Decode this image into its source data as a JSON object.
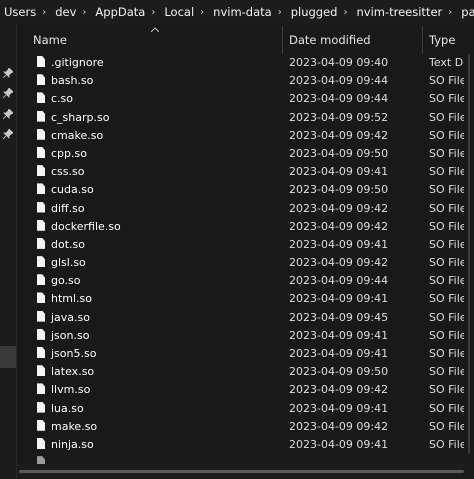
{
  "breadcrumb": [
    "Users",
    "dev",
    "AppData",
    "Local",
    "nvim-data",
    "plugged",
    "nvim-treesitter",
    "parser"
  ],
  "breadcrumb_separator": "›",
  "columns": {
    "name": "Name",
    "date_modified": "Date modified",
    "type": "Type"
  },
  "files": [
    {
      "name": ".gitignore",
      "date": "2023-04-09 09:40",
      "type": "Text Docu"
    },
    {
      "name": "bash.so",
      "date": "2023-04-09 09:44",
      "type": "SO File"
    },
    {
      "name": "c.so",
      "date": "2023-04-09 09:44",
      "type": "SO File"
    },
    {
      "name": "c_sharp.so",
      "date": "2023-04-09 09:52",
      "type": "SO File"
    },
    {
      "name": "cmake.so",
      "date": "2023-04-09 09:42",
      "type": "SO File"
    },
    {
      "name": "cpp.so",
      "date": "2023-04-09 09:50",
      "type": "SO File"
    },
    {
      "name": "css.so",
      "date": "2023-04-09 09:41",
      "type": "SO File"
    },
    {
      "name": "cuda.so",
      "date": "2023-04-09 09:50",
      "type": "SO File"
    },
    {
      "name": "diff.so",
      "date": "2023-04-09 09:42",
      "type": "SO File"
    },
    {
      "name": "dockerfile.so",
      "date": "2023-04-09 09:42",
      "type": "SO File"
    },
    {
      "name": "dot.so",
      "date": "2023-04-09 09:41",
      "type": "SO File"
    },
    {
      "name": "glsl.so",
      "date": "2023-04-09 09:42",
      "type": "SO File"
    },
    {
      "name": "go.so",
      "date": "2023-04-09 09:44",
      "type": "SO File"
    },
    {
      "name": "html.so",
      "date": "2023-04-09 09:41",
      "type": "SO File"
    },
    {
      "name": "java.so",
      "date": "2023-04-09 09:45",
      "type": "SO File"
    },
    {
      "name": "json.so",
      "date": "2023-04-09 09:41",
      "type": "SO File"
    },
    {
      "name": "json5.so",
      "date": "2023-04-09 09:41",
      "type": "SO File"
    },
    {
      "name": "latex.so",
      "date": "2023-04-09 09:50",
      "type": "SO File"
    },
    {
      "name": "llvm.so",
      "date": "2023-04-09 09:42",
      "type": "SO File"
    },
    {
      "name": "lua.so",
      "date": "2023-04-09 09:41",
      "type": "SO File"
    },
    {
      "name": "make.so",
      "date": "2023-04-09 09:42",
      "type": "SO File"
    },
    {
      "name": "ninja.so",
      "date": "2023-04-09 09:41",
      "type": "SO File"
    }
  ],
  "icons": {
    "file": "file-icon",
    "pin": "pin-icon",
    "sort": "sort-up-icon"
  },
  "colors": {
    "background": "#191919",
    "text": "#ffffff",
    "secondary_text": "#dcdcdc"
  }
}
